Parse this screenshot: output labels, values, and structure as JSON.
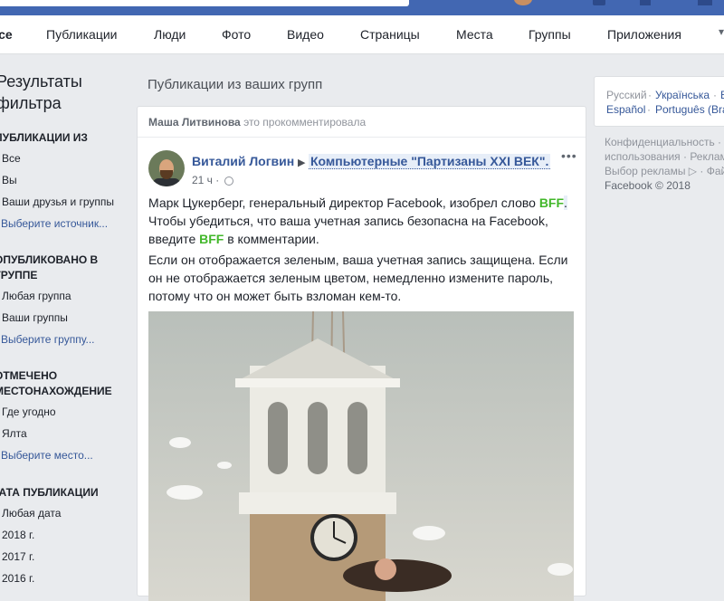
{
  "nav": {
    "tabs": [
      {
        "label": "Все"
      },
      {
        "label": "Публикации"
      },
      {
        "label": "Люди"
      },
      {
        "label": "Фото"
      },
      {
        "label": "Видео"
      },
      {
        "label": "Страницы"
      },
      {
        "label": "Места"
      },
      {
        "label": "Группы"
      },
      {
        "label": "Приложения"
      }
    ]
  },
  "filters": {
    "title_line1": "Результаты",
    "title_line2": "фильтра",
    "sections": [
      {
        "title": "Публикации из",
        "options": [
          "Все",
          "Вы",
          "Ваши друзья и группы"
        ],
        "link": "Выберите источник..."
      },
      {
        "title_line1": "Опубликовано в",
        "title_line2": "группе",
        "options": [
          "Любая группа",
          "Ваши группы"
        ],
        "link": "Выберите группу..."
      },
      {
        "title_line1": "Отмечено",
        "title_line2": "местонахождение",
        "options": [
          "Где угодно",
          "Ялта"
        ],
        "link": "Выберите место..."
      },
      {
        "title": "Дата публикации",
        "options": [
          "Любая дата",
          "2018 г.",
          "2017 г.",
          "2016 г."
        ]
      }
    ]
  },
  "feed": {
    "heading": "Публикации из ваших групп",
    "commenter_name": "Маша Литвинова",
    "commenter_action": "это прокомментировала",
    "post": {
      "author": "Виталий Логвин",
      "group": "Компьютерные \"Партизаны XXI ВЕК\".",
      "time": "21 ч",
      "para1_a": "Марк Цукерберг, генеральный директор Facebook, изобрел слово ",
      "para1_bff1": "BFF",
      "para1_b": ".",
      "para1_c": "Чтобы убедиться, что ваша учетная запись безопасна на Facebook, введите ",
      "para1_bff2": "BFF",
      "para1_d": " в комментарии.",
      "para2": "Если он отображается зеленым, ваша учетная запись защищена. Если он не отображается зеленым цветом, немедленно измените пароль, потому что он может быть взломан кем-то."
    }
  },
  "sidebar": {
    "languages": [
      "Русский",
      "Українська",
      "E",
      "Español",
      "Português (Bra"
    ],
    "footer_line1": "Конфиденциальность ·",
    "footer_line2": "использования · Реклам",
    "footer_line3": "Выбор рекламы ▷ · Фай",
    "copyright": "Facebook © 2018"
  },
  "colors": {
    "brand_blue": "#4267b2",
    "link_blue": "#365899",
    "bff_green": "#42b72a",
    "background": "#e9ebee"
  }
}
